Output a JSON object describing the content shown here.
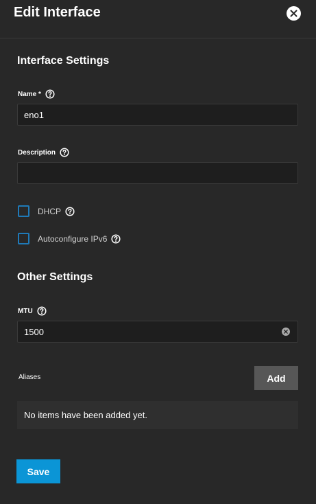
{
  "header": {
    "title": "Edit Interface"
  },
  "sections": {
    "interface_settings": "Interface Settings",
    "other_settings": "Other Settings"
  },
  "fields": {
    "name": {
      "label": "Name *",
      "value": "eno1"
    },
    "description": {
      "label": "Description",
      "value": ""
    },
    "mtu": {
      "label": "MTU",
      "value": "1500"
    }
  },
  "checkboxes": {
    "dhcp": {
      "label": "DHCP",
      "checked": false
    },
    "autoconfigure_ipv6": {
      "label": "Autoconfigure IPv6",
      "checked": false
    }
  },
  "aliases": {
    "label": "Aliases",
    "add_label": "Add",
    "empty_text": "No items have been added yet."
  },
  "actions": {
    "save_label": "Save"
  },
  "colors": {
    "background": "#282828",
    "input_background": "#1e1e1e",
    "primary": "#0b95d6",
    "checkbox_border": "#1f7ab8",
    "secondary_button": "#575757"
  },
  "icons": {
    "close": "close-icon",
    "help": "help-icon",
    "clear": "clear-icon"
  }
}
